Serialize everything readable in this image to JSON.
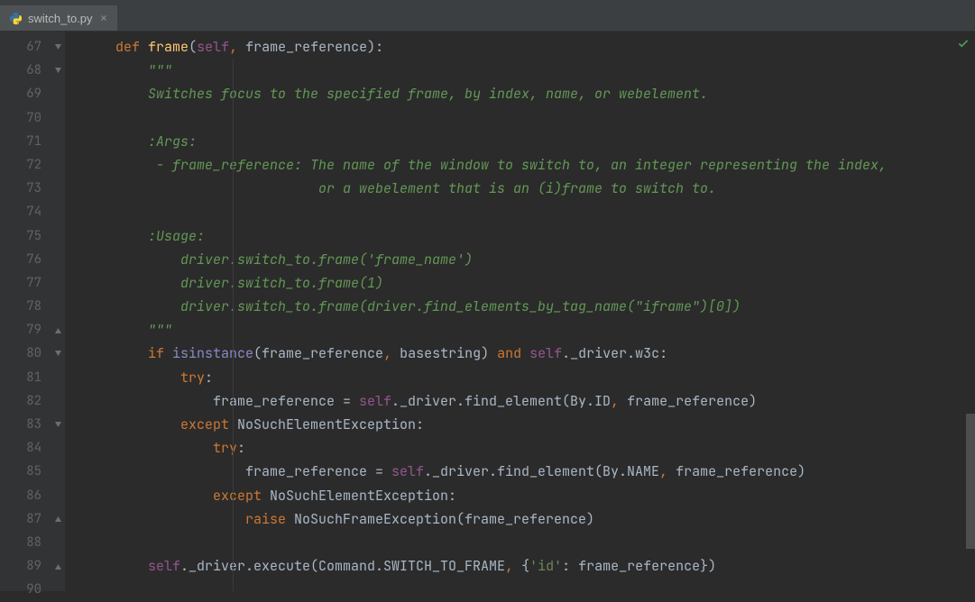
{
  "tab": {
    "filename": "switch_to.py",
    "close": "×"
  },
  "gutter": {
    "start": 67,
    "end": 90
  },
  "code": {
    "l67": {
      "def": "def",
      "name": "frame",
      "lp": "(",
      "self": "self",
      "c": ", ",
      "p": "frame_reference",
      "rp": "):"
    },
    "l68": {
      "t": "        \"\"\""
    },
    "l69": {
      "t": "        Switches focus to the specified frame, by index, name, or webelement."
    },
    "l70": {
      "t": ""
    },
    "l71": {
      "t": "        :Args:"
    },
    "l72": {
      "t": "         - frame_reference: The name of the window to switch to, an integer representing the index,"
    },
    "l73": {
      "t": "                             or a webelement that is an (i)frame to switch to."
    },
    "l74": {
      "t": ""
    },
    "l75": {
      "t": "        :Usage:"
    },
    "l76": {
      "t": "            driver.switch_to.frame('frame_name')"
    },
    "l77": {
      "t": "            driver.switch_to.frame(1)"
    },
    "l78": {
      "t": "            driver.switch_to.frame(driver.find_elements_by_tag_name(\"iframe\")[0])"
    },
    "l79": {
      "t": "        \"\"\""
    },
    "l80": {
      "if": "if ",
      "isin": "isinstance",
      "lp": "(frame_reference",
      "c": ", ",
      "base": "basestring) ",
      "and": "and ",
      "self": "self",
      "rest": "._driver.w3c:"
    },
    "l81": {
      "try": "try",
      "colon": ":"
    },
    "l82": {
      "pre": "                frame_reference = ",
      "self": "self",
      "mid": "._driver.find_element(By.ID",
      "c": ", ",
      "end": "frame_reference)"
    },
    "l83": {
      "except": "except ",
      "exc": "NoSuchElementException:"
    },
    "l84": {
      "try": "try",
      "colon": ":"
    },
    "l85": {
      "pre": "                    frame_reference = ",
      "self": "self",
      "mid": "._driver.find_element(By.NAME",
      "c": ", ",
      "end": "frame_reference)"
    },
    "l86": {
      "except": "except ",
      "exc": "NoSuchElementException:"
    },
    "l87": {
      "raise": "raise ",
      "rest": "NoSuchFrameException(frame_reference)"
    },
    "l88": {
      "t": ""
    },
    "l89": {
      "self": "self",
      "pre": "._driver.execute(Command.SWITCH_TO_FRAME",
      "c": ", ",
      "lb": "{",
      "key": "'id'",
      "colon": ": frame_reference})"
    }
  }
}
